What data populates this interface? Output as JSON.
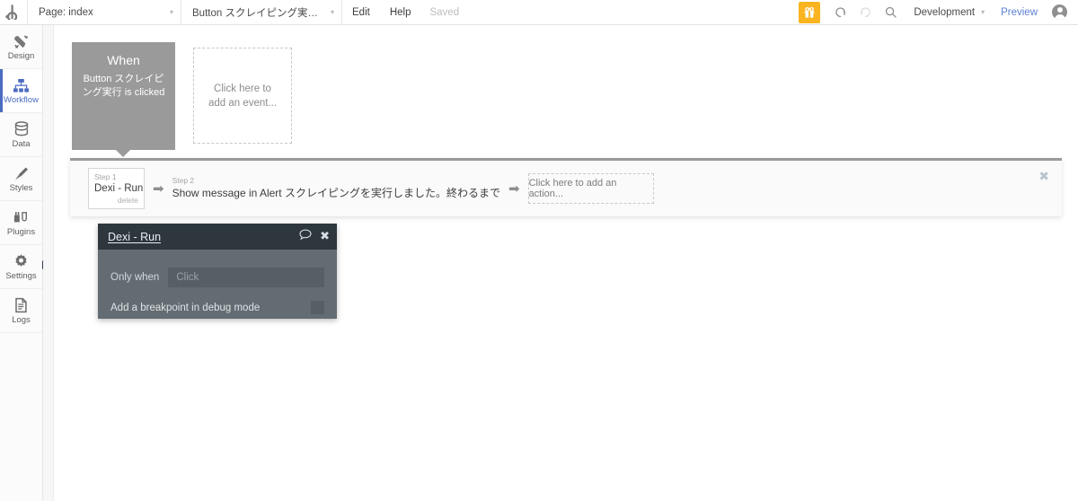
{
  "topbar": {
    "logo": "b",
    "page_select": {
      "label": "Page: index",
      "caret": "▾"
    },
    "event_select": {
      "label": "Button スクレイピング実行 is clic...",
      "caret": "▾"
    },
    "edit_label": "Edit",
    "help_label": "Help",
    "saved_label": "Saved",
    "gift_icon": "gift-icon",
    "undo_icon": "undo-icon",
    "redo_icon": "redo-icon",
    "search_icon": "search-icon",
    "environment": {
      "label": "Development",
      "caret": "▾"
    },
    "preview_label": "Preview",
    "avatar": "user-avatar",
    "accent_color": "#f9b41f",
    "link_color": "#5c7fd6"
  },
  "sidebar": {
    "items": [
      {
        "label": "Design",
        "icon": "design-icon",
        "active": false
      },
      {
        "label": "Workflow",
        "icon": "workflow-icon",
        "active": true
      },
      {
        "label": "Data",
        "icon": "data-icon",
        "active": false
      },
      {
        "label": "Styles",
        "icon": "styles-icon",
        "active": false
      },
      {
        "label": "Plugins",
        "icon": "plugins-icon",
        "active": false
      },
      {
        "label": "Settings",
        "icon": "settings-icon",
        "active": false
      },
      {
        "label": "Logs",
        "icon": "logs-icon",
        "active": false
      }
    ],
    "active_color": "#4b6cc1",
    "expander_icon": "expand-right-icon"
  },
  "canvas": {
    "event_box": {
      "when_label": "When",
      "description": "Button スクレイピング実行 is clicked",
      "bg_color": "#9a9a9a"
    },
    "add_event_placeholder": "Click here to add an event..."
  },
  "actions_bar": {
    "steps": [
      {
        "step_label": "Step 1",
        "title": "Dexi - Run",
        "delete_label": "delete"
      },
      {
        "step_label": "Step 2",
        "title": "Show message in Alert スクレイピングを実行しました。終わるまで"
      }
    ],
    "arrow_glyph": "➡",
    "add_action_placeholder": "Click here to add an action...",
    "close_glyph": "✖"
  },
  "property_panel": {
    "title": "Dexi - Run",
    "comment_icon": "comment-icon",
    "close_icon": "close-icon",
    "close_glyph": "✖",
    "only_when": {
      "label": "Only when",
      "placeholder": "Click",
      "value": ""
    },
    "breakpoint": {
      "label": "Add a breakpoint in debug mode",
      "checked": false
    },
    "header_color": "#2e373e",
    "body_color": "#636c72"
  }
}
